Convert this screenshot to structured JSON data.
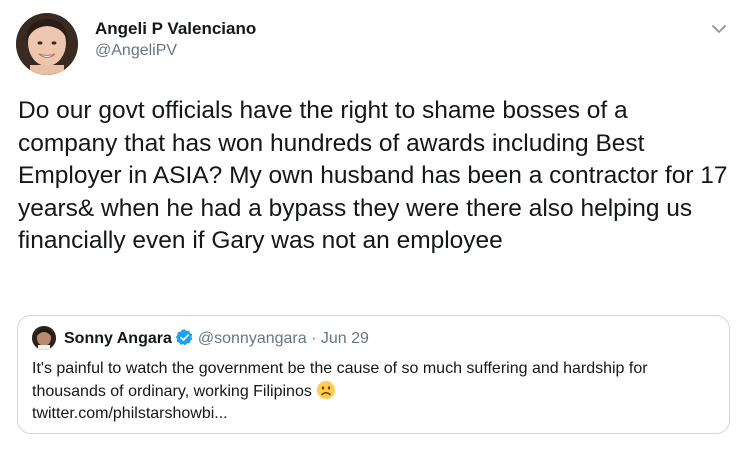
{
  "tweet": {
    "author": {
      "name": "Angeli P Valenciano",
      "handle": "@AngeliPV"
    },
    "text": "Do our govt officials have the right to shame bosses of a company that has won hundreds of awards including Best Employer in ASIA? My own husband has been a contractor for 17 years& when he had a bypass they were there also helping us financially even if Gary was not an employee",
    "icons": {
      "menu": "chevron-down-icon",
      "avatar": "profile-photo"
    }
  },
  "quoted_tweet": {
    "author": {
      "name": "Sonny Angara",
      "handle": "@sonnyangara",
      "verified": true
    },
    "separator": "·",
    "date": "Jun 29",
    "text": "It's painful to watch the government be the cause of so much suffering and hardship for thousands of ordinary, working Filipinos",
    "emoji": "frowning-face-icon",
    "link": "twitter.com/philstarshowbi..."
  },
  "colors": {
    "primary_text": "#14171a",
    "secondary_text": "#657786",
    "border": "#ccd6dd",
    "verified_badge": "#1da1f2"
  }
}
